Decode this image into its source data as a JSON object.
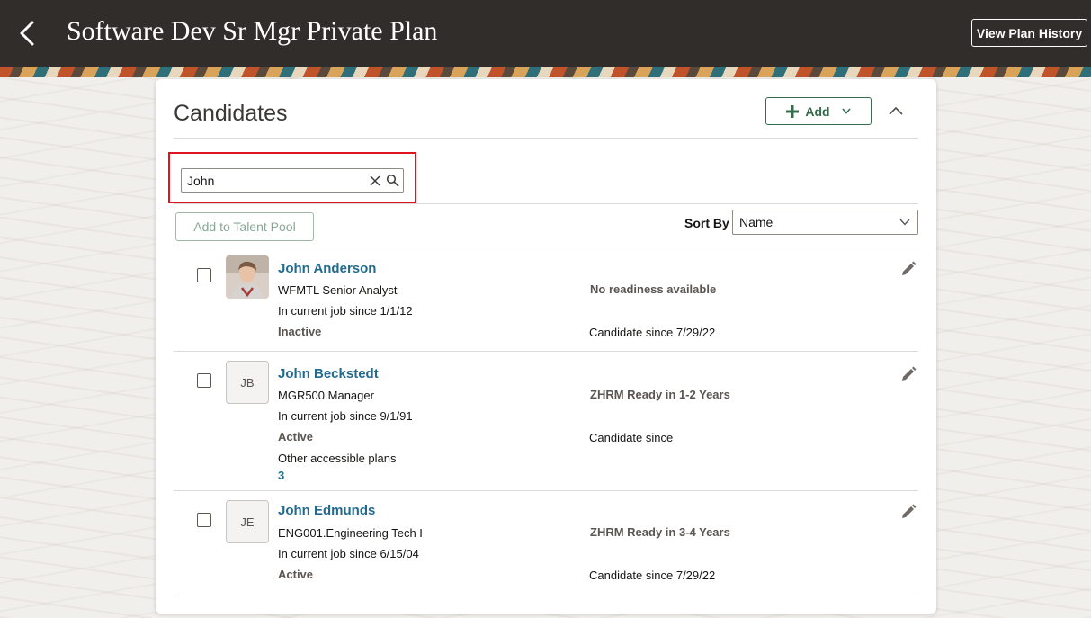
{
  "header": {
    "title": "Software Dev Sr Mgr Private Plan",
    "history_button": "View Plan History"
  },
  "panel": {
    "title": "Candidates",
    "add_label": "Add"
  },
  "search": {
    "value": "John"
  },
  "toolbar": {
    "talent_pool_label": "Add to Talent Pool",
    "sort_label": "Sort By",
    "sort_value": "Name"
  },
  "candidates": [
    {
      "name": "John Anderson",
      "job": "WFMTL Senior Analyst",
      "job_since": "In current job since 1/1/12",
      "status": "Inactive",
      "readiness": "No readiness available",
      "candidate_since": "Candidate since 7/29/22",
      "avatar": "photo"
    },
    {
      "name": "John Beckstedt",
      "initials": "JB",
      "job": "MGR500.Manager",
      "job_since": "In current job since 9/1/91",
      "status": "Active",
      "readiness": "ZHRM Ready in 1-2 Years",
      "candidate_since": "Candidate since",
      "other_plans_label": "Other accessible plans",
      "other_plans_count": "3"
    },
    {
      "name": "John Edmunds",
      "initials": "JE",
      "job": "ENG001.Engineering Tech I",
      "job_since": "In current job since 6/15/04",
      "status": "Active",
      "readiness": "ZHRM Ready in 3-4 Years",
      "candidate_since": "Candidate since 7/29/22"
    }
  ],
  "colors": {
    "header_bg": "#312d2a",
    "link": "#226a8f",
    "accent_green": "#356d4c",
    "highlight": "#e0121e"
  }
}
